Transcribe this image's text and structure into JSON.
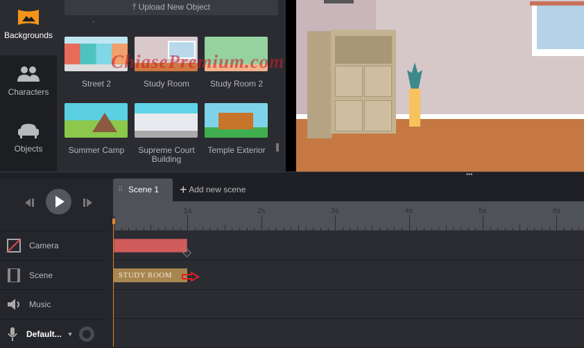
{
  "sidebar": {
    "items": [
      {
        "label": "Backgrounds",
        "icon": "backgrounds-icon",
        "active": true
      },
      {
        "label": "Characters",
        "icon": "characters-icon"
      },
      {
        "label": "Objects",
        "icon": "objects-icon"
      }
    ],
    "accent": "#f39418"
  },
  "panel": {
    "upload_label": "Upload New Object",
    "dash": "-",
    "backgrounds": [
      {
        "label": "Street 2"
      },
      {
        "label": "Study Room"
      },
      {
        "label": "Study Room 2"
      },
      {
        "label": "Summer Camp"
      },
      {
        "label": "Supreme Court Building"
      },
      {
        "label": "Temple Exterior"
      }
    ]
  },
  "watermark": "ChiasePremium.com",
  "timeline": {
    "tabs": [
      {
        "label": "Scene 1",
        "active": true
      }
    ],
    "add_scene_label": "Add new scene",
    "ruler_labels": [
      "1s",
      "2s",
      "3s",
      "4s",
      "5s",
      "6s"
    ],
    "tracks": [
      {
        "label": "Camera",
        "icon": "camera-icon"
      },
      {
        "label": "Scene",
        "icon": "film-icon"
      },
      {
        "label": "Music",
        "icon": "speaker-icon"
      },
      {
        "label": "Default...",
        "icon": "microphone-icon"
      }
    ],
    "camera_clip": {
      "start_s": 0,
      "end_s": 1,
      "color": "#d05c5c"
    },
    "scene_clip": {
      "label": "STUDY ROOM",
      "start_s": 0,
      "end_s": 1,
      "color": "#a8864f"
    },
    "playhead_s": 0,
    "playhead_color": "#e8842a"
  }
}
